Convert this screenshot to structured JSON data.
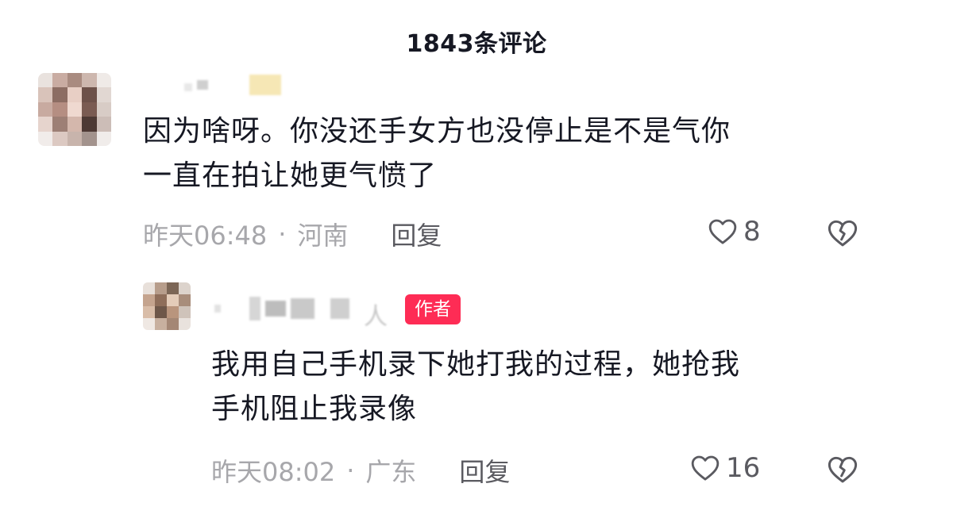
{
  "header": {
    "title": "1843条评论"
  },
  "comment": {
    "text_line1": "因为啥呀。你没还手女方也没停止是不是气你",
    "text_line2": "一直在拍让她更气愤了",
    "time": "昨天06:48",
    "separator": "·",
    "location": "河南",
    "reply_label": "回复",
    "like_count": "8",
    "icons": {
      "like": "heart-outline-icon",
      "dislike": "broken-heart-icon"
    }
  },
  "reply": {
    "username_suffix": "人",
    "author_badge": "作者",
    "text_line1": "我用自己手机录下她打我的过程，她抢我",
    "text_line2": "手机阻止我录像",
    "time": "昨天08:02",
    "separator": "·",
    "location": "广东",
    "reply_label": "回复",
    "like_count": "16"
  },
  "colors": {
    "text_primary": "#161823",
    "text_secondary": "#a7a7ab",
    "author_badge_bg": "#fe2c55"
  }
}
